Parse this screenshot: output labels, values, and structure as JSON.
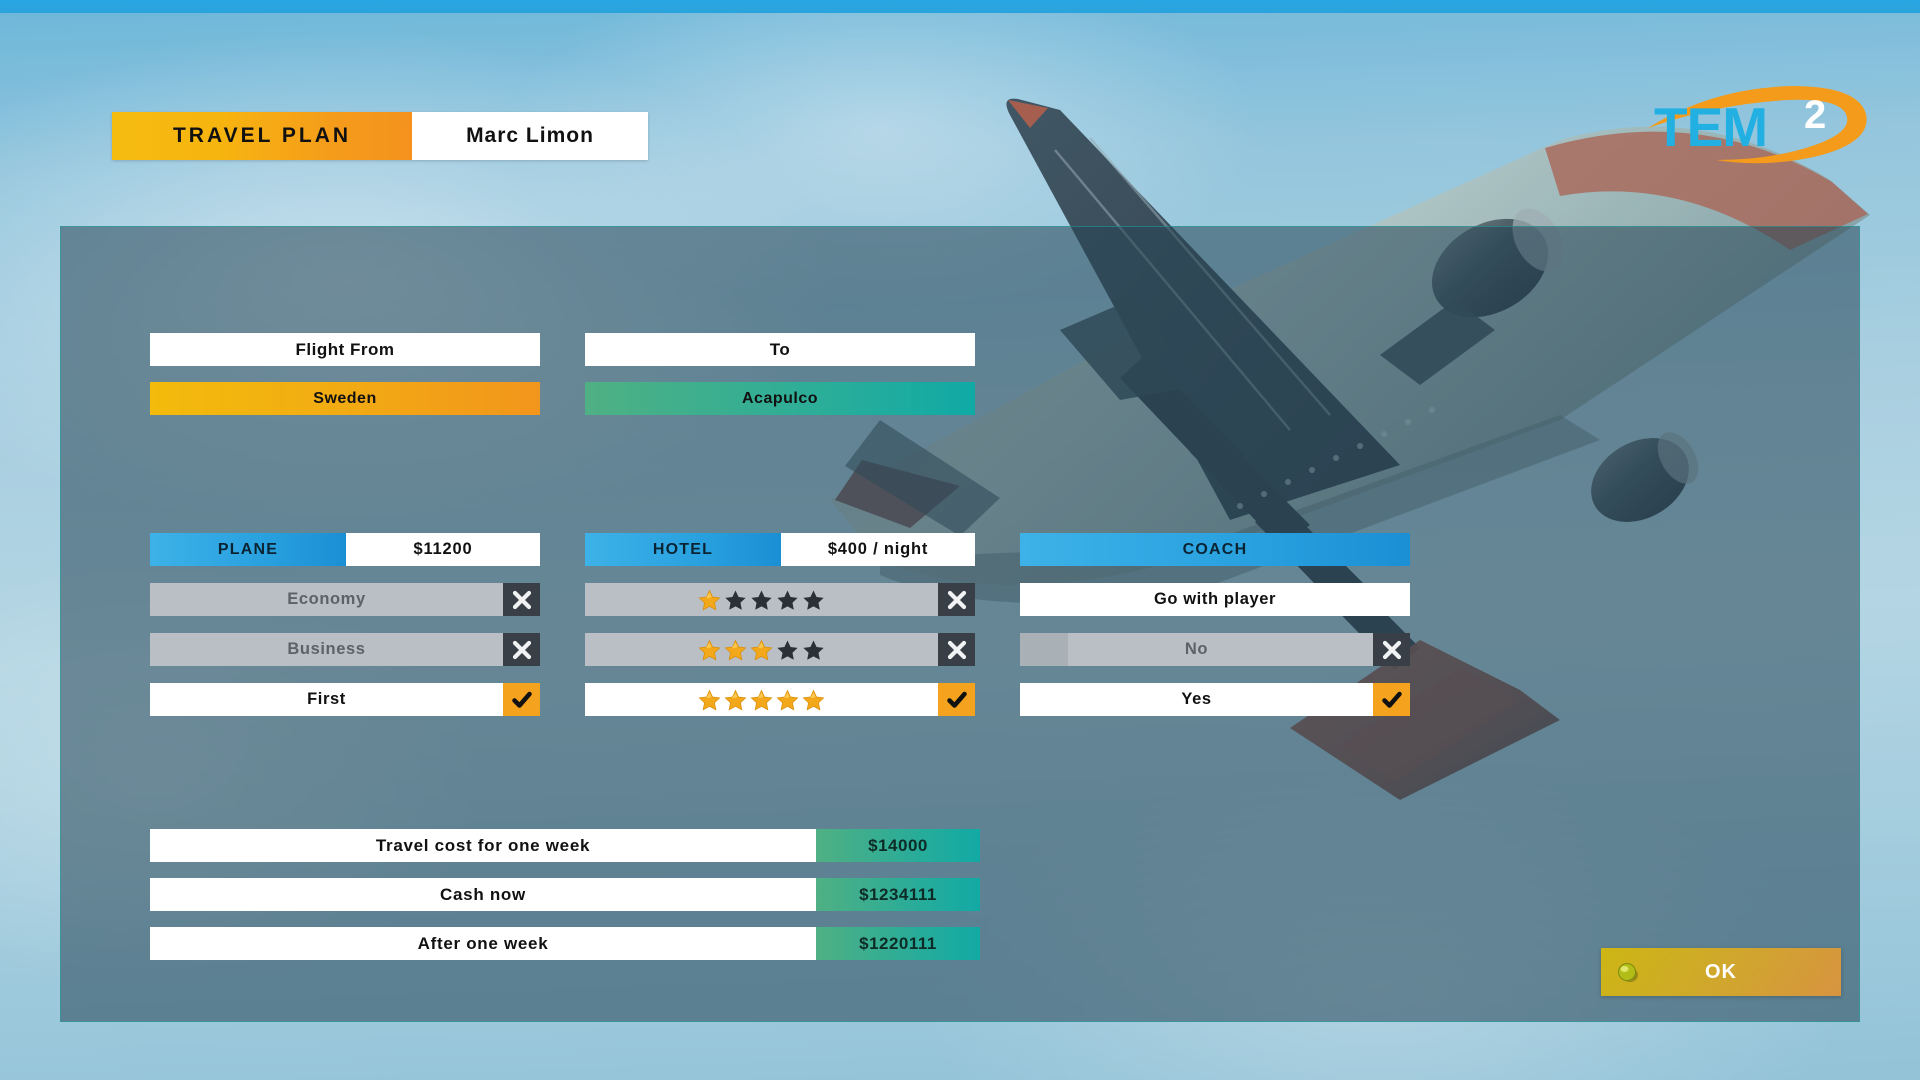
{
  "header": {
    "title": "TRAVEL PLAN",
    "player_name": "Marc Limon"
  },
  "logo": {
    "text": "TEM",
    "superscript": "2"
  },
  "flight": {
    "from_label": "Flight From",
    "from_value": "Sweden",
    "to_label": "To",
    "to_value": "Acapulco"
  },
  "plane": {
    "tag": "PLANE",
    "price": "$11200",
    "options": [
      {
        "label": "Economy",
        "selected": false
      },
      {
        "label": "Business",
        "selected": false
      },
      {
        "label": "First",
        "selected": true
      }
    ]
  },
  "hotel": {
    "tag": "HOTEL",
    "price": "$400 / night",
    "options": [
      {
        "stars": 1,
        "max_stars": 5,
        "selected": false
      },
      {
        "stars": 3,
        "max_stars": 5,
        "selected": false
      },
      {
        "stars": 5,
        "max_stars": 5,
        "selected": true
      }
    ]
  },
  "coach": {
    "tag": "COACH",
    "question": "Go with player",
    "options": [
      {
        "label": "No",
        "selected": false
      },
      {
        "label": "Yes",
        "selected": true
      }
    ]
  },
  "summary": {
    "rows": [
      {
        "label": "Travel cost for one week",
        "value": "$14000"
      },
      {
        "label": "Cash now",
        "value": "$1234111"
      },
      {
        "label": "After one week",
        "value": "$1220111"
      }
    ]
  },
  "footer": {
    "ok_label": "OK"
  },
  "colors": {
    "accent_orange": "#f5a21e",
    "accent_gold": "#f3bb0c",
    "accent_blue": "#2aa2e0",
    "accent_green": "#29ac99",
    "star_gold": "#f3a81c",
    "star_off": "#2b3036",
    "gray_off": "#b9bfc4",
    "dark_btn": "#383f47",
    "top_strip": "#29a7e2"
  }
}
